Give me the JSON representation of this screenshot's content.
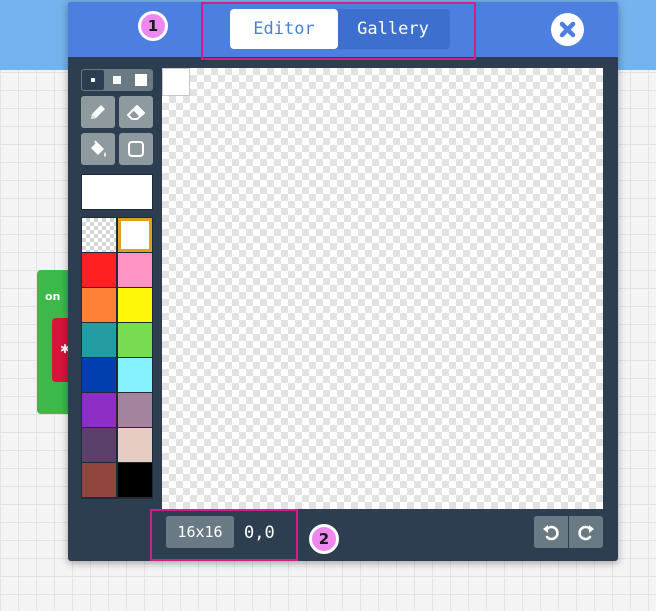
{
  "tabs": {
    "editor_label": "Editor",
    "gallery_label": "Gallery",
    "active": "Editor"
  },
  "background_block": {
    "label": "on",
    "inner_glyph": "✱"
  },
  "tools": {
    "brush_sizes": [
      "small",
      "medium",
      "large"
    ],
    "selected_size": "small",
    "items": [
      "pencil-icon",
      "eraser-icon",
      "fill-bucket-icon",
      "rectangle-icon"
    ]
  },
  "current_color": "#ffffff",
  "palette": [
    "transparent",
    "#ffffff",
    "#ff2121",
    "#ff93c4",
    "#ff8135",
    "#fff609",
    "#249ca3",
    "#78dc52",
    "#003fad",
    "#87f2ff",
    "#8e2ec4",
    "#a4839f",
    "#5c406c",
    "#e5cdc4",
    "#91463d",
    "#000000"
  ],
  "selected_color_index": 1,
  "footer": {
    "canvas_size": "16x16",
    "cursor_coords": "0,0"
  },
  "callouts": {
    "first": "1",
    "second": "2"
  },
  "colors": {
    "header": "#4c7fe0",
    "dialog": "#2d3e50",
    "callout": "#d81b8a",
    "badge": "#ee88ee"
  }
}
